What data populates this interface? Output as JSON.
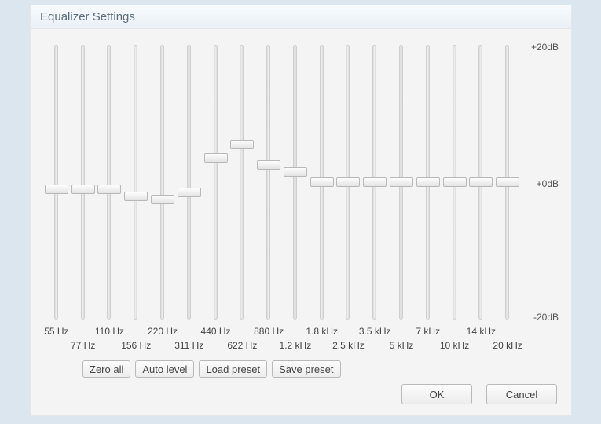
{
  "title": "Equalizer Settings",
  "scale": {
    "max_label": "+20dB",
    "zero_label": "+0dB",
    "min_label": "-20dB",
    "max_db": 20,
    "min_db": -20
  },
  "bands": [
    {
      "freq": "55 Hz",
      "db": -1.0
    },
    {
      "freq": "77 Hz",
      "db": -1.0
    },
    {
      "freq": "110 Hz",
      "db": -1.0
    },
    {
      "freq": "156 Hz",
      "db": -2.0
    },
    {
      "freq": "220 Hz",
      "db": -2.5
    },
    {
      "freq": "311 Hz",
      "db": -1.5
    },
    {
      "freq": "440 Hz",
      "db": 3.5
    },
    {
      "freq": "622 Hz",
      "db": 5.5
    },
    {
      "freq": "880 Hz",
      "db": 2.5
    },
    {
      "freq": "1.2 kHz",
      "db": 1.5
    },
    {
      "freq": "1.8 kHz",
      "db": 0.0
    },
    {
      "freq": "2.5 kHz",
      "db": 0.0
    },
    {
      "freq": "3.5 kHz",
      "db": 0.0
    },
    {
      "freq": "5 kHz",
      "db": 0.0
    },
    {
      "freq": "7 kHz",
      "db": 0.0
    },
    {
      "freq": "10 kHz",
      "db": 0.0
    },
    {
      "freq": "14 kHz",
      "db": 0.0
    },
    {
      "freq": "20 kHz",
      "db": 0.0
    }
  ],
  "toolbar": {
    "zero_all": "Zero all",
    "auto_level": "Auto level",
    "load_preset": "Load preset",
    "save_preset": "Save preset"
  },
  "footer": {
    "ok": "OK",
    "cancel": "Cancel"
  }
}
